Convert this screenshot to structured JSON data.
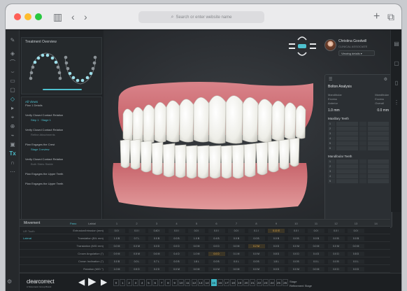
{
  "browser": {
    "url_placeholder": "Search or enter website name",
    "icons": [
      "sidebar-icon",
      "back-icon",
      "forward-icon",
      "new-tab-icon",
      "tabs-icon"
    ]
  },
  "colors": {
    "accent": "#4ec1cf",
    "warning": "#f0b44c",
    "background": "#202326",
    "gum": "#cf6f72",
    "teeth": "#f4f3ee"
  },
  "left_tools": [
    "pen-icon",
    "layers-icon",
    "upper-jaw-icon",
    "lower-jaw-icon",
    "tooth-icon",
    "stage-icon",
    "ruler-icon",
    "grid-icon",
    "attachment-icon",
    "tag-icon",
    "measure-icon",
    "text-icon",
    "arch-icon",
    "settings-icon"
  ],
  "right_tools": [
    "chat-icon",
    "document-icon",
    "copy-icon",
    "list-icon"
  ],
  "overview": {
    "title": "Treatment Overview"
  },
  "plan": {
    "heading": "All Views",
    "subheading": "Plan 1 Details",
    "steps": [
      {
        "label": "Verify Closed Contact Relation",
        "detail": "Step 1 · Stage 1"
      },
      {
        "label": "Verify Closed Contact Relation",
        "detail": "Refine Attachments"
      },
      {
        "label": "Plan Engages the Crest",
        "detail": "Stage 3 review"
      },
      {
        "label": "Verify Closed Contact Relation",
        "detail": "Both Sides Stable"
      },
      {
        "label": "Plan Engages the Upper Teeth",
        "detail": ""
      },
      {
        "label": "Plan Engages the Upper Teeth",
        "detail": ""
      }
    ]
  },
  "user": {
    "name": "Christina Goodwill",
    "sub": "CLINICAL ASSOCIATE",
    "select": "Viewing details"
  },
  "analysis": {
    "title": "Bolton Analysis",
    "left_labels": [
      "Mandibular",
      "Excess",
      "Anterior"
    ],
    "right_labels": [
      "Mandibular",
      "Excess",
      "Overall"
    ],
    "left_value": "1.0 mm",
    "right_value": "0.0 mm",
    "maxillary_title": "Maxillary Teeth",
    "mandibular_title": "Mandibular Teeth",
    "rows": [
      "1",
      "2",
      "3",
      "4",
      "5",
      "6"
    ]
  },
  "movement": {
    "title": "Movement",
    "toggles": [
      "Pano",
      "Labial"
    ],
    "columns": [
      "1",
      "2",
      "3",
      "4",
      "5",
      "6",
      "7",
      "8",
      "9",
      "10",
      "11",
      "12",
      "13",
      "14"
    ],
    "side_labels": [
      "UR Tooth",
      "Lateral"
    ],
    "rows": [
      {
        "label": "Extrusion/Intrusion (mm)",
        "cells": [
          "0.0 I",
          "0.0 I",
          "0.40 I",
          "0.0 I",
          "0.0 I",
          "0.0 I",
          "0.0 I",
          "0.1 I",
          "0.10 E",
          "0.0 I",
          "0.0 I",
          "0.0 I",
          "0.0 I"
        ],
        "warn": [
          8
        ]
      },
      {
        "label": "Translation (B/L mm)",
        "cells": [
          "1.0 B",
          "0.7 L",
          "0.0 B",
          "0.0 B",
          "1.0 B",
          "0.4 B",
          "0.0 B",
          "0.0 B",
          "0.0 B",
          "0.0 B",
          "0.0 B",
          "0.0 B",
          "0.0 B"
        ],
        "warn": []
      },
      {
        "label": "Translation (M/D mm)",
        "cells": [
          "0.0 M",
          "0.0 M",
          "0.0 D",
          "0.0 D",
          "0.0 M",
          "0.0 D",
          "0.0 M",
          "0.2 M",
          "0.0 D",
          "0.0 M",
          "0.0 M",
          "0.0 M",
          "0.0 M"
        ],
        "warn": [
          7
        ]
      },
      {
        "label": "Crown Angulation (°)",
        "cells": [
          "0.9 M",
          "0.5 M",
          "0.6 M",
          "0.4 D",
          "1.0 M",
          "0.0 D",
          "0.1 M",
          "0.0 M",
          "0.8 D",
          "0.0 D",
          "0.4 D",
          "0.0 D",
          "0.8 D"
        ],
        "warn": [
          5
        ]
      },
      {
        "label": "Crown Inclination (°)",
        "cells": [
          "0.0 B",
          "0.0 L",
          "0.7 L",
          "0.0 B",
          "1.8 L",
          "0.0 B",
          "0.0 L",
          "0.0 B",
          "1.8 L",
          "0.0 B",
          "0.0 L",
          "0.0 B",
          "0.0 L"
        ],
        "warn": []
      },
      {
        "label": "Rotation (M/D °)",
        "cells": [
          "1.0 M",
          "0.5 D",
          "0.2 D",
          "0.0 M",
          "0.0 M",
          "0.0 M",
          "0.0 M",
          "0.0 M",
          "0.0 D",
          "0.0 M",
          "0.0 M",
          "0.0 D",
          "0.0 D"
        ],
        "warn": []
      }
    ]
  },
  "footer": {
    "logo": "clearcorrect",
    "logo_sub": "A Straumann Group Brand",
    "stages": [
      "0",
      "1",
      "2",
      "3",
      "4",
      "5",
      "6",
      "7",
      "8",
      "9",
      "10",
      "11",
      "12",
      "13",
      "14",
      "15",
      "16",
      "17",
      "18",
      "19",
      "20",
      "21",
      "22",
      "23",
      "24",
      "25",
      "26"
    ],
    "current_stage": "15",
    "info_1": "Stage",
    "info_2": "Refinement Stage"
  }
}
